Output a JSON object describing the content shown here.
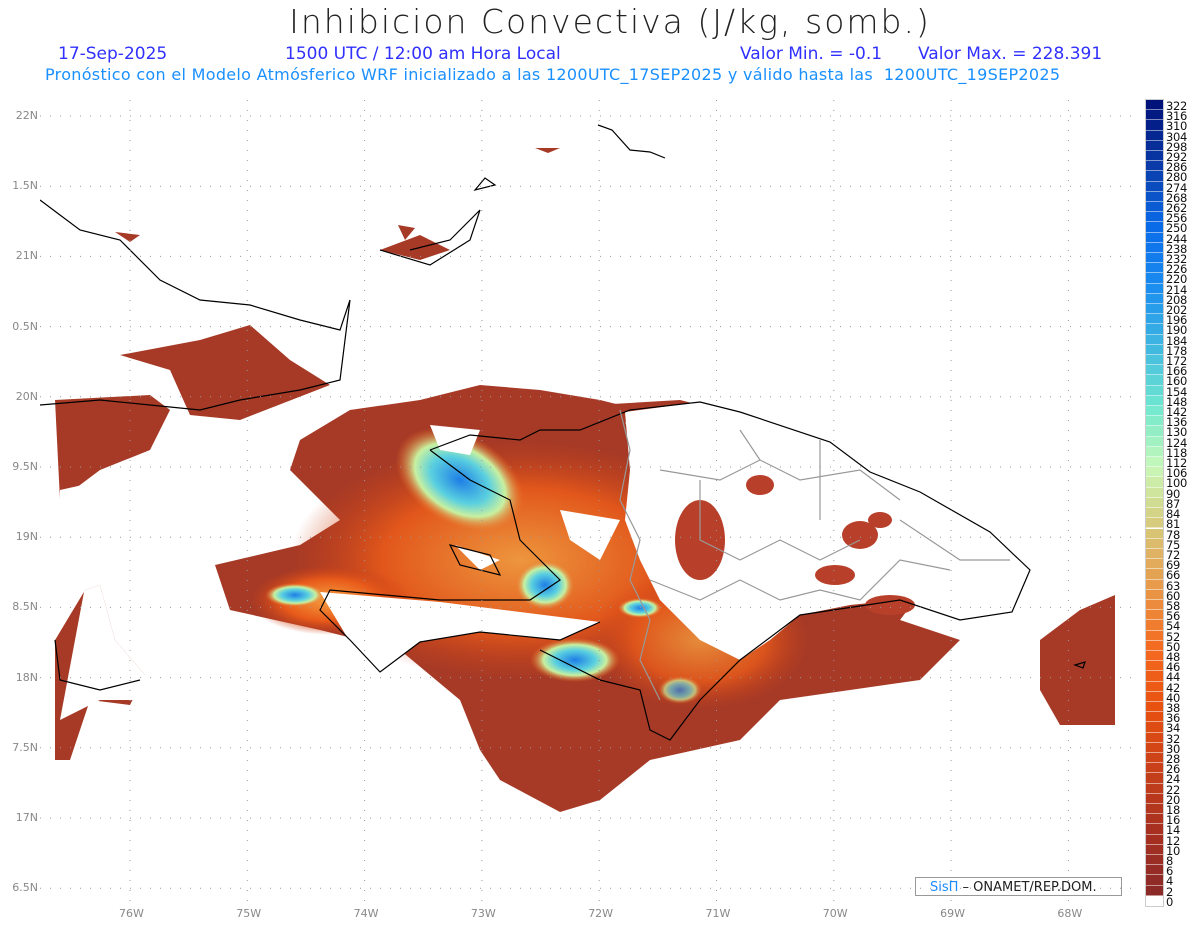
{
  "header": {
    "title": "Inhibicion Convectiva (J/kg, somb.)",
    "date": "17-Sep-2025",
    "time": "1500 UTC / 12:00 am Hora Local",
    "min": "Valor Min. = -0.1",
    "max": "Valor Max. = 228.391",
    "subtitle": "Pronóstico con el Modelo Atmósferico WRF inicializado a las 1200UTC_17SEP2025 y válido hasta las  1200UTC_19SEP2025"
  },
  "axes": {
    "lon_labels": [
      "76W",
      "75W",
      "74W",
      "73W",
      "72W",
      "71W",
      "70W",
      "69W",
      "68W"
    ],
    "lat_labels": [
      "22N",
      "1.5N",
      "21N",
      "0.5N",
      "20N",
      "9.5N",
      "19N",
      "8.5N",
      "18N",
      "7.5N",
      "17N",
      "6.5N"
    ]
  },
  "colorbar": {
    "labels": [
      "322",
      "316",
      "310",
      "304",
      "298",
      "292",
      "286",
      "280",
      "274",
      "268",
      "262",
      "256",
      "250",
      "244",
      "238",
      "232",
      "226",
      "220",
      "214",
      "208",
      "202",
      "196",
      "190",
      "184",
      "178",
      "172",
      "166",
      "160",
      "154",
      "148",
      "142",
      "136",
      "130",
      "124",
      "118",
      "112",
      "106",
      "100",
      "90",
      "87",
      "84",
      "81",
      "78",
      "75",
      "72",
      "69",
      "66",
      "63",
      "60",
      "58",
      "56",
      "54",
      "52",
      "50",
      "48",
      "46",
      "44",
      "42",
      "40",
      "38",
      "36",
      "34",
      "32",
      "30",
      "28",
      "26",
      "24",
      "22",
      "20",
      "18",
      "16",
      "14",
      "12",
      "10",
      "8",
      "6",
      "4",
      "2",
      "0"
    ],
    "color_stops": [
      "#00137a",
      "#0a3aa8",
      "#0a6ae8",
      "#1a8cf0",
      "#40b8e0",
      "#70e8d0",
      "#c8f8b8",
      "#d8c878",
      "#e89848",
      "#f56a20",
      "#e85010",
      "#c8401a",
      "#a83020",
      "#8c2a28",
      "#ffffff"
    ]
  },
  "credit": {
    "brand": "SisΠ",
    "text": " –  ONAMET/REP.DOM."
  },
  "colors": {
    "field_low": "#a0352a",
    "field_mid": "#e0561c",
    "field_high": "#1e96e6",
    "land": "#ffffff"
  }
}
